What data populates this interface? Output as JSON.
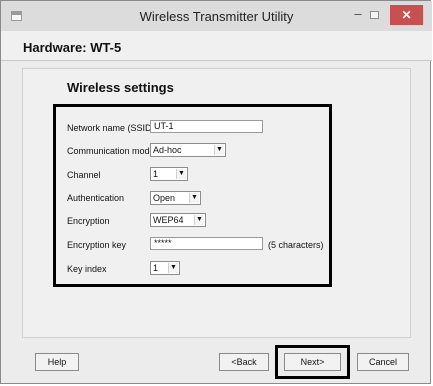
{
  "window": {
    "title": "Wireless Transmitter Utility",
    "min_glyph": "–",
    "close_glyph": "✕"
  },
  "header": {
    "hardware_label": "Hardware: WT-5"
  },
  "settings": {
    "section_title": "Wireless settings",
    "network_name_label": "Network name (SSID)",
    "network_name_value": "UT-1",
    "communication_mode_label": "Communication mode",
    "communication_mode_value": "Ad-hoc",
    "channel_label": "Channel",
    "channel_value": "1",
    "authentication_label": "Authentication",
    "authentication_value": "Open",
    "encryption_label": "Encryption",
    "encryption_value": "WEP64",
    "encryption_key_label": "Encryption key",
    "encryption_key_value": "*****",
    "encryption_key_hint": "(5 characters)",
    "key_index_label": "Key index",
    "key_index_value": "1"
  },
  "buttons": {
    "help": "Help",
    "back": "<Back",
    "next": "Next>",
    "cancel": "Cancel"
  },
  "icons": {
    "dropdown_arrow": "▼"
  }
}
